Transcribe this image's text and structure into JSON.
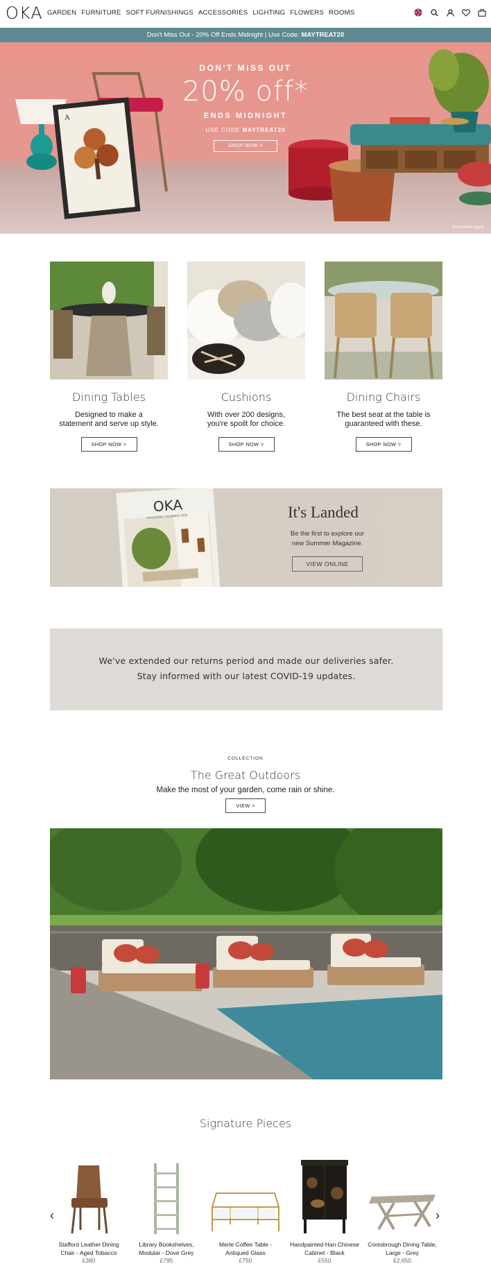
{
  "header": {
    "logo": "OKA",
    "nav": [
      "GARDEN",
      "FURNITURE",
      "SOFT FURNISHINGS",
      "ACCESSORIES",
      "LIGHTING",
      "FLOWERS",
      "ROOMS"
    ],
    "icons": [
      "uk-flag-icon",
      "search-icon",
      "account-icon",
      "heart-icon",
      "basket-icon"
    ]
  },
  "promo": {
    "text": "Don't Miss Out - 20% Off Ends Midnight | Use Code:",
    "code": "MAYTREAT20",
    "bg_color": "#5d8a91"
  },
  "hero": {
    "kicker": "DON'T MISS OUT",
    "headline": "20% off*",
    "subline": "ENDS MIDNIGHT",
    "code_label": "USE CODE",
    "code": "MAYTREAT20",
    "button": "SHOP NOW >",
    "fine_print": "*Exclusions apply"
  },
  "categories": [
    {
      "title": "Dining Tables",
      "desc_1": "Designed to make a",
      "desc_2": "statement and serve up style.",
      "button": "SHOP NOW >"
    },
    {
      "title": "Cushions",
      "desc_1": "With over 200 designs,",
      "desc_2": "you're spoilt for choice.",
      "button": "SHOP NOW >"
    },
    {
      "title": "Dining Chairs",
      "desc_1": "The best seat at the table is",
      "desc_2": "guaranteed with these.",
      "button": "SHOP NOW >"
    }
  ],
  "magazine": {
    "cover_logo": "OKA",
    "cover_sub": "MAGAZINE | SUMMER 2020",
    "title": "It's Landed",
    "text_1": "Be the first to explore our",
    "text_2": "new Summer Magazine.",
    "button": "VIEW ONLINE"
  },
  "notice": {
    "line_1": "We've extended our returns period and made our deliveries safer.",
    "line_2": "Stay informed with our latest COVID-19 updates."
  },
  "collection": {
    "kicker": "COLLECTION",
    "title": "The Great Outdoors",
    "subtitle": "Make the most of your garden, come rain or shine.",
    "button": "VIEW >"
  },
  "signature": {
    "title": "Signature Pieces",
    "prev": "‹",
    "next": "›",
    "products": [
      {
        "name_1": "Stafford Leather Dining",
        "name_2": "Chair - Aged Tobacco",
        "price": "£380"
      },
      {
        "name_1": "Library Bookshelves,",
        "name_2": "Modular - Dove Grey",
        "price": "£795"
      },
      {
        "name_1": "Merle Coffee Table -",
        "name_2": "Antiqued Glass",
        "price": "£750"
      },
      {
        "name_1": "Handpainted Han Chinese",
        "name_2": "Cabinet - Black",
        "price": "£550"
      },
      {
        "name_1": "Conisbrough Dining Table,",
        "name_2": "Large - Grey",
        "price": "£2,650"
      }
    ]
  }
}
